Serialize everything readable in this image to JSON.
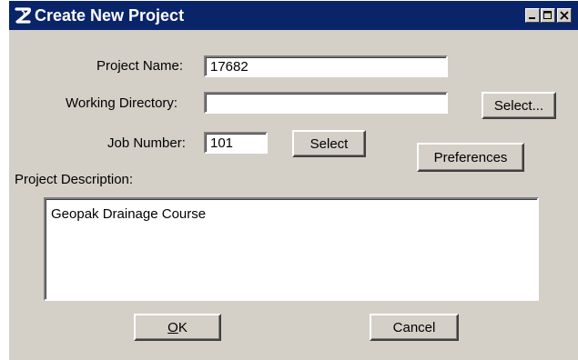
{
  "window": {
    "title": "Create New Project",
    "minimize_label": "minimize",
    "maximize_label": "maximize",
    "close_label": "close"
  },
  "form": {
    "project_name_label": "Project Name:",
    "project_name_value": "17682",
    "working_directory_label": "Working Directory:",
    "working_directory_value": "",
    "job_number_label": "Job Number:",
    "job_number_value": "101",
    "project_description_label": "Project Description:",
    "project_description_value": "Geopak Drainage Course"
  },
  "buttons": {
    "select_directory": "Select...",
    "select_job": "Select",
    "preferences": "Preferences",
    "ok_mnemonic": "O",
    "ok_rest": "K",
    "cancel": "Cancel"
  }
}
